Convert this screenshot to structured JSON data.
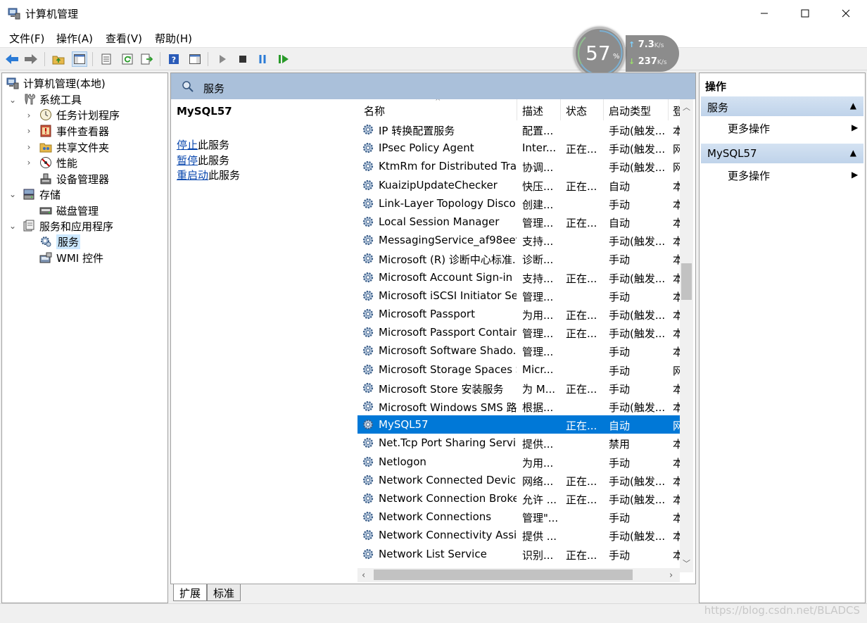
{
  "window": {
    "title": "计算机管理",
    "minimize": "—",
    "maximize": "☐",
    "close": "✕"
  },
  "menu": [
    "文件(F)",
    "操作(A)",
    "查看(V)",
    "帮助(H)"
  ],
  "net_widget": {
    "cpu_percent": "57",
    "percent_sign": "%",
    "upload": "7.3",
    "download": "237",
    "unit": "K/s"
  },
  "tree": [
    {
      "label": "计算机管理(本地)"
    },
    {
      "label": "系统工具"
    },
    {
      "label": "任务计划程序"
    },
    {
      "label": "事件查看器"
    },
    {
      "label": "共享文件夹"
    },
    {
      "label": "性能"
    },
    {
      "label": "设备管理器"
    },
    {
      "label": "存储"
    },
    {
      "label": "磁盘管理"
    },
    {
      "label": "服务和应用程序"
    },
    {
      "label": "服务"
    },
    {
      "label": "WMI 控件"
    }
  ],
  "center": {
    "header": "服务",
    "service_name": "MySQL57",
    "actions": [
      {
        "link": "停止",
        "suffix": "此服务"
      },
      {
        "link": "暂停",
        "suffix": "此服务"
      },
      {
        "link": "重启动",
        "suffix": "此服务"
      }
    ]
  },
  "grid": {
    "columns": [
      "名称",
      "描述",
      "状态",
      "启动类型",
      "登"
    ],
    "rows": [
      {
        "name": "IP 转换配置服务",
        "desc": "配置...",
        "status": "",
        "startup": "手动(触发...",
        "logon": "本"
      },
      {
        "name": "IPsec Policy Agent",
        "desc": "Inter...",
        "status": "正在...",
        "startup": "手动(触发...",
        "logon": "网"
      },
      {
        "name": "KtmRm for Distributed Tra...",
        "desc": "协调...",
        "status": "",
        "startup": "手动(触发...",
        "logon": "网"
      },
      {
        "name": "KuaizipUpdateChecker",
        "desc": "快压...",
        "status": "正在...",
        "startup": "自动",
        "logon": "本"
      },
      {
        "name": "Link-Layer Topology Disco...",
        "desc": "创建...",
        "status": "",
        "startup": "手动",
        "logon": "本"
      },
      {
        "name": "Local Session Manager",
        "desc": "管理...",
        "status": "正在...",
        "startup": "自动",
        "logon": "本"
      },
      {
        "name": "MessagingService_af98eef",
        "desc": "支持...",
        "status": "",
        "startup": "手动(触发...",
        "logon": "本"
      },
      {
        "name": "Microsoft (R) 诊断中心标准...",
        "desc": "诊断...",
        "status": "",
        "startup": "手动",
        "logon": "本"
      },
      {
        "name": "Microsoft Account Sign-in ...",
        "desc": "支持...",
        "status": "正在...",
        "startup": "手动(触发...",
        "logon": "本"
      },
      {
        "name": "Microsoft iSCSI Initiator Ser...",
        "desc": "管理...",
        "status": "",
        "startup": "手动",
        "logon": "本"
      },
      {
        "name": "Microsoft Passport",
        "desc": "为用...",
        "status": "正在...",
        "startup": "手动(触发...",
        "logon": "本"
      },
      {
        "name": "Microsoft Passport Container",
        "desc": "管理...",
        "status": "正在...",
        "startup": "手动(触发...",
        "logon": "本"
      },
      {
        "name": "Microsoft Software Shado...",
        "desc": "管理...",
        "status": "",
        "startup": "手动",
        "logon": "本"
      },
      {
        "name": "Microsoft Storage Spaces S...",
        "desc": "Micr...",
        "status": "",
        "startup": "手动",
        "logon": "网"
      },
      {
        "name": "Microsoft Store 安装服务",
        "desc": "为 M...",
        "status": "正在...",
        "startup": "手动",
        "logon": "本"
      },
      {
        "name": "Microsoft Windows SMS 路...",
        "desc": "根据...",
        "status": "",
        "startup": "手动(触发...",
        "logon": "本"
      },
      {
        "name": "MySQL57",
        "desc": "",
        "status": "正在...",
        "startup": "自动",
        "logon": "网"
      },
      {
        "name": "Net.Tcp Port Sharing Service",
        "desc": "提供...",
        "status": "",
        "startup": "禁用",
        "logon": "本"
      },
      {
        "name": "Netlogon",
        "desc": "为用...",
        "status": "",
        "startup": "手动",
        "logon": "本"
      },
      {
        "name": "Network Connected Devic...",
        "desc": "网络...",
        "status": "正在...",
        "startup": "手动(触发...",
        "logon": "本"
      },
      {
        "name": "Network Connection Broker",
        "desc": "允许 ...",
        "status": "正在...",
        "startup": "手动(触发...",
        "logon": "本"
      },
      {
        "name": "Network Connections",
        "desc": "管理\"...",
        "status": "",
        "startup": "手动",
        "logon": "本"
      },
      {
        "name": "Network Connectivity Assis...",
        "desc": "提供 ...",
        "status": "",
        "startup": "手动(触发...",
        "logon": "本"
      },
      {
        "name": "Network List Service",
        "desc": "识别...",
        "status": "正在...",
        "startup": "手动",
        "logon": "本"
      }
    ]
  },
  "tabs": [
    "扩展",
    "标准"
  ],
  "actions_pane": {
    "title": "操作",
    "sections": [
      {
        "label": "服务",
        "item": "更多操作"
      },
      {
        "label": "MySQL57",
        "item": "更多操作"
      }
    ]
  },
  "status": {
    "watermark": "https://blog.csdn.net/BLADCS"
  },
  "colors": {
    "selection": "#0078d7",
    "header_band": "#aac0da",
    "link": "#0645ad"
  }
}
